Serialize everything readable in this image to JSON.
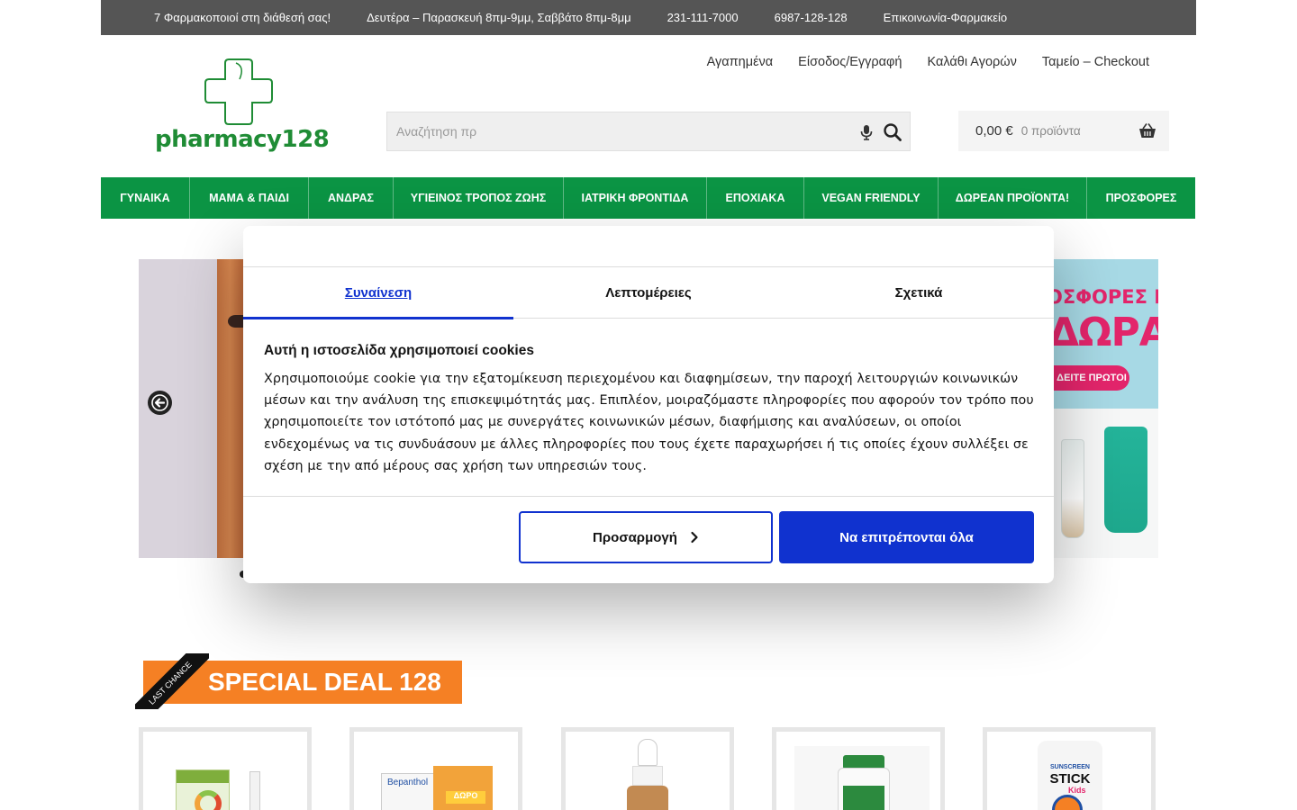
{
  "topbar": {
    "pharmacists": "7 Φαρμακοποιοί στη διάθεσή σας!",
    "hours": "Δευτέρα – Παρασκευή 8πμ-9μμ, Σαββάτο 8πμ-8μμ",
    "phone1": "231-111-7000",
    "phone2": "6987-128-128",
    "contact": "Επικοινωνία-Φαρμακείο"
  },
  "logo": {
    "text": "pharmacy128"
  },
  "topnav": {
    "favorites": "Αγαπημένα",
    "login": "Είσοδος/Εγγραφή",
    "cart": "Καλάθι Αγορών",
    "checkout": "Ταμείο – Checkout"
  },
  "search": {
    "placeholder": "Αναζήτηση πρ",
    "icons": [
      "microphone-icon",
      "search-icon"
    ]
  },
  "cart": {
    "amount": "0,00 €",
    "count": "0 προϊόντα",
    "icon": "basket-icon"
  },
  "mainnav": [
    "ΓΥΝΑΙΚΑ",
    "ΜΑΜΑ & ΠΑΙΔΙ",
    "ΑΝΔΡΑΣ",
    "ΥΓΙΕΙΝΟΣ ΤΡΟΠΟΣ ΖΩΗΣ",
    "ΙΑΤΡΙΚΗ ΦΡΟΝΤΙΔΑ",
    "ΕΠΟΧΙΑΚΑ",
    "VEGAN FRIENDLY",
    "ΔΩΡΕΑΝ ΠΡΟΪΟΝΤΑ!",
    "ΠΡΟΣΦΟΡΕΣ"
  ],
  "promo": {
    "line1": "ΟΣΦΟΡΕΣ ΜΕ",
    "line2": "ΔΩΡΑ!",
    "button": "ΔΕΙΤΕ ΠΡΩΤΟΙ"
  },
  "cookie_dialog": {
    "tabs": [
      "Συναίνεση",
      "Λεπτομέρειες",
      "Σχετικά"
    ],
    "active_tab": "Συναίνεση",
    "title": "Αυτή η ιστοσελίδα χρησιμοποιεί cookies",
    "body": "Χρησιμοποιούμε cookie για την εξατομίκευση περιεχομένου και διαφημίσεων, την παροχή λειτουργιών κοινωνικών μέσων και την ανάλυση της επισκεψιμότητάς μας. Επιπλέον, μοιραζόμαστε πληροφορίες που αφορούν τον τρόπο που χρησιμοποιείτε τον ιστότοπό μας με συνεργάτες κοινωνικών μέσων, διαφήμισης και αναλύσεων, οι οποίοι ενδεχομένως να τις συνδυάσουν με άλλες πληροφορίες που τους έχετε παραχωρήσει ή τις οποίες έχουν συλλέξει σε σχέση με την από μέρους σας χρήση των υπηρεσιών τους.",
    "customize_button": "Προσαρμογή",
    "allow_all_button": "Να επιτρέπονται όλα"
  },
  "deal": {
    "ribbon": "LAST CHANCE",
    "title": "SPECIAL DEAL 128"
  },
  "products": {
    "p2_brand": "Bepanthol",
    "p2_gift": "ΔΩΡΟ",
    "p5_line1": "SUNSCREEN",
    "p5_line2": "STICK",
    "p5_line3": "Kids"
  },
  "colors": {
    "green": "#0b9444",
    "topbar": "#555555",
    "consent_blue": "#1032cf",
    "deal_orange": "#f58024"
  }
}
